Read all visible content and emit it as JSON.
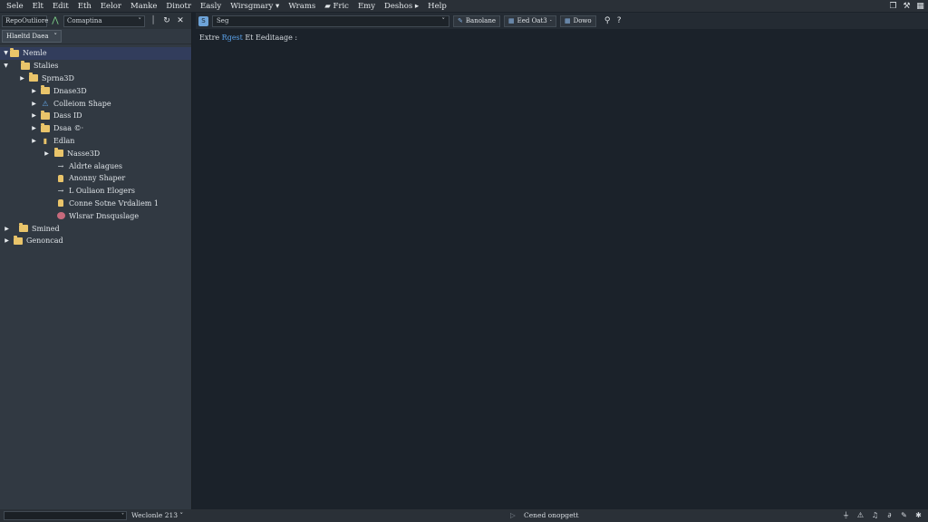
{
  "menubar": {
    "items": [
      "Sele",
      "Elt",
      "Edit",
      "Eth",
      "Eelor",
      "Manke",
      "Dinotr",
      "Easly",
      "Wirsgmary",
      "Wrams",
      "Fric",
      "Emy",
      "Deshos",
      "Help"
    ],
    "right_icons": [
      "copy-icon",
      "tools-icon",
      "grid-icon"
    ]
  },
  "left_panel": {
    "toolbar": {
      "field1": "RepoOutliore",
      "field2": "Comaptina",
      "icons": [
        "filter-icon",
        "chevron-down-icon",
        "pipe-icon",
        "cursor-icon",
        "close-icon"
      ]
    },
    "subtab": {
      "label": "Hlaeltd Daea",
      "chevron": "˅"
    },
    "tree": [
      {
        "label": "Nemle",
        "level": 0,
        "arrow": "▼",
        "icon": "folder",
        "selected": true
      },
      {
        "label": "Stalies",
        "level": 1,
        "arrow": "▼",
        "icon": "folder"
      },
      {
        "label": "Sprna3D",
        "level": 2,
        "arrow": "▶",
        "icon": "folder"
      },
      {
        "label": "Dnase3D",
        "level": 3,
        "arrow": "▶",
        "icon": "folder"
      },
      {
        "label": "Colleiom Shape",
        "level": 3,
        "arrow": "▶",
        "icon": "shape"
      },
      {
        "label": "Dass ID",
        "level": 3,
        "arrow": "▶",
        "icon": "folder"
      },
      {
        "label": "Dsaa ©·",
        "level": 3,
        "arrow": "▶",
        "icon": "folder"
      },
      {
        "label": "Edlan",
        "level": 3,
        "arrow": "▶",
        "icon": "bar"
      },
      {
        "label": "Nasse3D",
        "level": 4,
        "arrow": "▶",
        "icon": "folder"
      },
      {
        "label": "Aldrte alagues",
        "level": 4,
        "arrow": "",
        "icon": "arrow"
      },
      {
        "label": "Anonny Shaper",
        "level": 4,
        "arrow": "",
        "icon": "lock"
      },
      {
        "label": "L Ouliaon Elogers",
        "level": 4,
        "arrow": "",
        "icon": "arrow"
      },
      {
        "label": "Conne Sotne Vrdaliem 1",
        "level": 4,
        "arrow": "",
        "icon": "lock"
      },
      {
        "label": "Wlsrar Dnsquslage",
        "level": 4,
        "arrow": "",
        "icon": "gem"
      },
      {
        "label": "Smined",
        "level": 0,
        "arrow": "▶",
        "icon": "folder"
      },
      {
        "label": "Genoncad",
        "level": 0,
        "arrow": "▶",
        "icon": "folder"
      }
    ]
  },
  "editor": {
    "tab_icon": "script-icon",
    "search": {
      "value": "Seg",
      "chevron": "˅"
    },
    "buttons": [
      {
        "icon": "✎",
        "label": "Banolane"
      },
      {
        "icon": "▦",
        "label": "Eed Oat3",
        "suffix": "·"
      },
      {
        "icon": "▦",
        "label": "Dowo"
      }
    ],
    "extra_icons": [
      "search-help-icon",
      "help-icon"
    ],
    "line": {
      "prefix": "Extre ",
      "highlight": "Rgest",
      "suffix": " Et Eeditaage :"
    }
  },
  "statusbar": {
    "field_chevron": "˅",
    "left_text": "Weclonle 213 ˅",
    "center_text": "Cened onopgett",
    "center_icon": "▷",
    "right_icons": [
      "mic-icon",
      "alert-icon",
      "bell-icon",
      "link-icon",
      "pen-icon",
      "bug-icon"
    ]
  }
}
